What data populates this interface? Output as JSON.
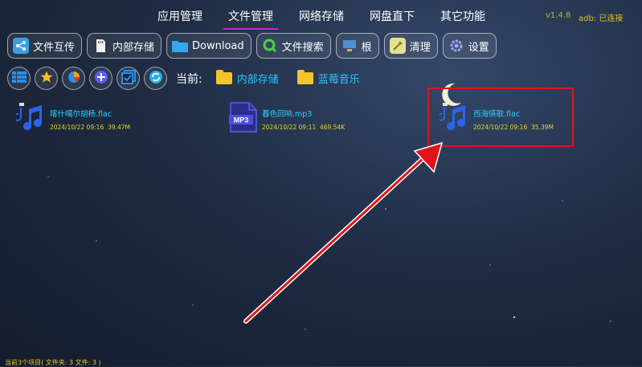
{
  "top_nav": {
    "tabs": [
      {
        "label": "应用管理",
        "active": false
      },
      {
        "label": "文件管理",
        "active": true
      },
      {
        "label": "网络存储",
        "active": false
      },
      {
        "label": "网盘直下",
        "active": false
      },
      {
        "label": "其它功能",
        "active": false
      }
    ],
    "version": "v1.4.8",
    "adb_status": "adb: 已连接"
  },
  "toolbar": {
    "buttons": [
      {
        "label": "文件互传",
        "icon": "share-icon"
      },
      {
        "label": "内部存储",
        "icon": "sd-card-icon"
      },
      {
        "label": "Download",
        "icon": "folder-icon"
      },
      {
        "label": "文件搜索",
        "icon": "search-icon"
      },
      {
        "label": "根",
        "icon": "root-icon"
      },
      {
        "label": "清理",
        "icon": "broom-icon"
      },
      {
        "label": "设置",
        "icon": "gear-icon"
      }
    ]
  },
  "path_bar": {
    "current_label": "当前:",
    "crumbs": [
      "内部存储",
      "蓝莓音乐"
    ]
  },
  "files": [
    {
      "name": "喀什噶尔胡杨.flac",
      "date": "2024/10/22 09:16",
      "size": "39.47M",
      "type": "flac"
    },
    {
      "name": "暮色回响.mp3",
      "date": "2024/10/22 09:11",
      "size": "469.54K",
      "type": "mp3"
    },
    {
      "name": "西海情歌.flac",
      "date": "2024/10/22 09:16",
      "size": "35.39M",
      "type": "flac"
    }
  ],
  "status_bar": "当前3个项目( 文件夹: 3  文件: 3 )",
  "colors": {
    "accent": "#d020d0",
    "file_name": "#2ad1ff",
    "meta": "#e8d820",
    "highlight": "#e0141a"
  }
}
